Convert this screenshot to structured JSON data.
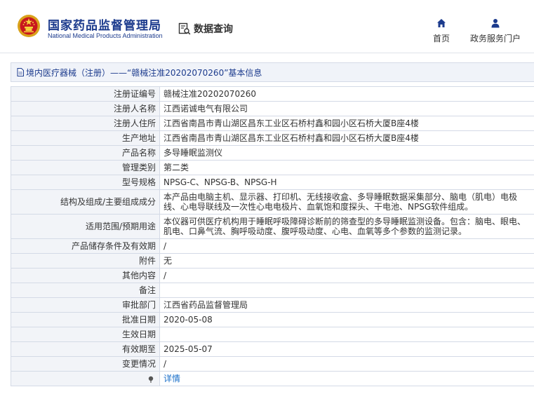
{
  "header": {
    "org_name_cn": "国家药品监督管理局",
    "org_name_en": "National Medical Products Administration",
    "query_label": "数据查询",
    "nav": {
      "home_label": "首页",
      "service_label": "政务服务门户"
    }
  },
  "breadcrumb": {
    "text": "境内医疗器械（注册）——“赣械注准20202070260”基本信息"
  },
  "colors": {
    "brand_blue": "#1c3b8d",
    "link_blue": "#1a6fc9",
    "key_bg": "#f2f4f8",
    "border": "#d4dae6"
  },
  "icons": {
    "emblem": "national-emblem-icon",
    "query": "search-document-icon",
    "home": "home-icon",
    "service": "user-icon",
    "breadcrumb": "document-icon",
    "detail": "pin-icon"
  },
  "rows": [
    {
      "label": "注册证编号",
      "value": "赣械注准20202070260"
    },
    {
      "label": "注册人名称",
      "value": "江西诺诚电气有限公司"
    },
    {
      "label": "注册人住所",
      "value": "江西省南昌市青山湖区昌东工业区石桥村鑫和园小区石桥大厦B座4楼"
    },
    {
      "label": "生产地址",
      "value": "江西省南昌市青山湖区昌东工业区石桥村鑫和园小区石桥大厦B座4楼"
    },
    {
      "label": "产品名称",
      "value": "多导睡眠监测仪"
    },
    {
      "label": "管理类别",
      "value": "第二类"
    },
    {
      "label": "型号规格",
      "value": "NPSG-C、NPSG-B、NPSG-H"
    },
    {
      "label": "结构及组成/主要组成成分",
      "value": "本产品由电脑主机、显示器、打印机、无线接收盒、多导睡眠数据采集部分、脑电（肌电）电极线、心电导联线及一次性心电电极片、血氧饱和度探头、干电池、NPSG软件组成。"
    },
    {
      "label": "适用范围/预期用途",
      "value": "本仪器可供医疗机构用于睡眠呼吸障碍诊断前的筛查型的多导睡眠监测设备。包含：脑电、眼电、肌电、口鼻气流、胸呼吸动度、腹呼吸动度、心电、血氧等多个参数的监测记录。"
    },
    {
      "label": "产品储存条件及有效期",
      "value": "/"
    },
    {
      "label": "附件",
      "value": "无"
    },
    {
      "label": "其他内容",
      "value": "/"
    },
    {
      "label": "备注",
      "value": ""
    },
    {
      "label": "审批部门",
      "value": "江西省药品监督管理局"
    },
    {
      "label": "批准日期",
      "value": "2020-05-08"
    },
    {
      "label": "生效日期",
      "value": ""
    },
    {
      "label": "有效期至",
      "value": "2025-05-07"
    },
    {
      "label": "变更情况",
      "value": "/"
    }
  ],
  "detail_link": "详情"
}
